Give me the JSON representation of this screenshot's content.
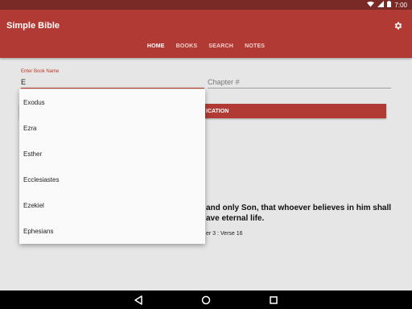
{
  "status": {
    "time": "7:00"
  },
  "app": {
    "title": "Simple Bible"
  },
  "tabs": [
    {
      "label": "HOME"
    },
    {
      "label": "BOOKS"
    },
    {
      "label": "SEARCH"
    },
    {
      "label": "NOTES"
    }
  ],
  "form": {
    "book_label": "Enter Book Name",
    "book_value": "E",
    "chapter_placeholder": "Chapter #",
    "button_visible_label": "ICATION"
  },
  "dropdown": {
    "options": [
      "Exodus",
      "Ezra",
      "Esther",
      "Ecclesiastes",
      "Ezekiel",
      "Ephesians"
    ]
  },
  "verse": {
    "text_line1": "and only Son, that whoever believes in him shall",
    "text_line2": "ave eternal life.",
    "reference": "er 3 : Verse 16"
  },
  "colors": {
    "primary": "#b23a34",
    "status_bar": "#7a2a26",
    "background": "#e6e6e6"
  }
}
